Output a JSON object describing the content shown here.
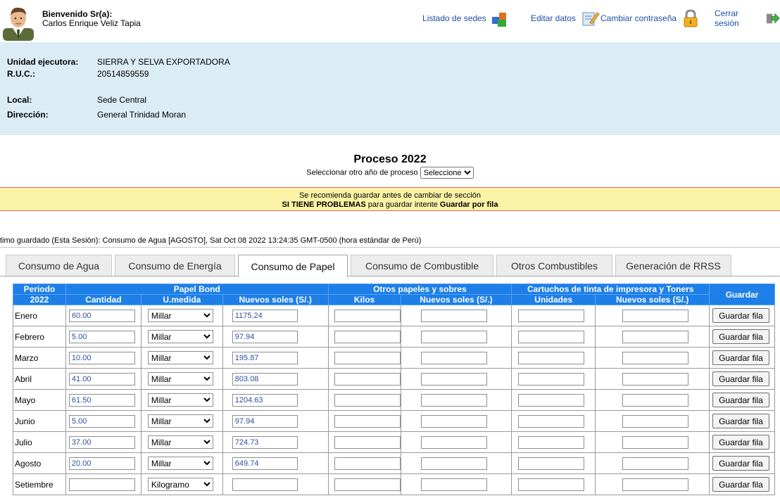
{
  "header": {
    "welcome": "Bienvenido Sr(a):",
    "user_name": "Carlos Enrique Veliz Tapia",
    "nav": {
      "sedes": "Listado de sedes",
      "editar": "Editar datos",
      "password": "Cambiar contraseña",
      "logout": "Cerrar sesión"
    }
  },
  "info": {
    "unidad_label": "Unidad ejecutora:",
    "unidad_value": "SIERRA Y SELVA EXPORTADORA",
    "ruc_label": "R.U.C.:",
    "ruc_value": "20514859559",
    "local_label": "Local:",
    "local_value": "Sede Central",
    "direccion_label": "Dirección:",
    "direccion_value": "General Trinidad Moran"
  },
  "process": {
    "title": "Proceso 2022",
    "selector_label": "Seleccionar otro año de proceso",
    "selector_value": "Seleccione"
  },
  "warning": {
    "line1": "Se recomienda guardar antes de cambiar de sección",
    "line2_bold": "SI TIENE PROBLEMAS",
    "line2_mid": " para guardar intente ",
    "line2_bold2": "Guardar por fila"
  },
  "last_saved": "timo guardado (Esta Sesión): Consumo de Agua [AGOSTO], Sat Oct 08 2022 13:24:35 GMT-0500 (hora estándar de Perú)",
  "tabs": [
    "Consumo de Agua",
    "Consumo de Energía",
    "Consumo de Papel",
    "Consumo de Combustible",
    "Otros Combustibles",
    "Generación de RRSS"
  ],
  "table": {
    "periodo_label": "Periodo",
    "periodo_year": "2022",
    "group_papel": "Papel Bond",
    "group_otros": "Otros papeles y sobres",
    "group_cartuchos": "Cartuchos de tinta de impresora y Toners",
    "guardar_header": "Guardar",
    "col_cantidad": "Cantidad",
    "col_umedida": "U.medida",
    "col_soles1": "Nuevos soles (S/.)",
    "col_kilos": "Kilos",
    "col_soles2": "Nuevos soles (S/.)",
    "col_unidades": "Unidades",
    "col_soles3": "Nuevos soles (S/.)",
    "button_label": "Guardar fila",
    "rows": [
      {
        "month": "Enero",
        "cantidad": "60.00",
        "unidad": "Millar",
        "soles": "1175.24"
      },
      {
        "month": "Febrero",
        "cantidad": "5.00",
        "unidad": "Millar",
        "soles": "97.94"
      },
      {
        "month": "Marzo",
        "cantidad": "10.00",
        "unidad": "Millar",
        "soles": "195.87"
      },
      {
        "month": "Abril",
        "cantidad": "41.00",
        "unidad": "Millar",
        "soles": "803.08"
      },
      {
        "month": "Mayo",
        "cantidad": "61.50",
        "unidad": "Millar",
        "soles": "1204.63"
      },
      {
        "month": "Junio",
        "cantidad": "5.00",
        "unidad": "Millar",
        "soles": "97.94"
      },
      {
        "month": "Julio",
        "cantidad": "37.00",
        "unidad": "Millar",
        "soles": "724.73"
      },
      {
        "month": "Agosto",
        "cantidad": "20.00",
        "unidad": "Millar",
        "soles": "649.74"
      },
      {
        "month": "Setiembre",
        "cantidad": "",
        "unidad": "Kilogramo",
        "soles": ""
      }
    ]
  },
  "icons": {
    "avatar": "user-avatar-icon",
    "sedes": "blocks-icon",
    "editar": "edit-pencil-icon",
    "password": "padlock-icon",
    "logout": "exit-door-icon"
  }
}
